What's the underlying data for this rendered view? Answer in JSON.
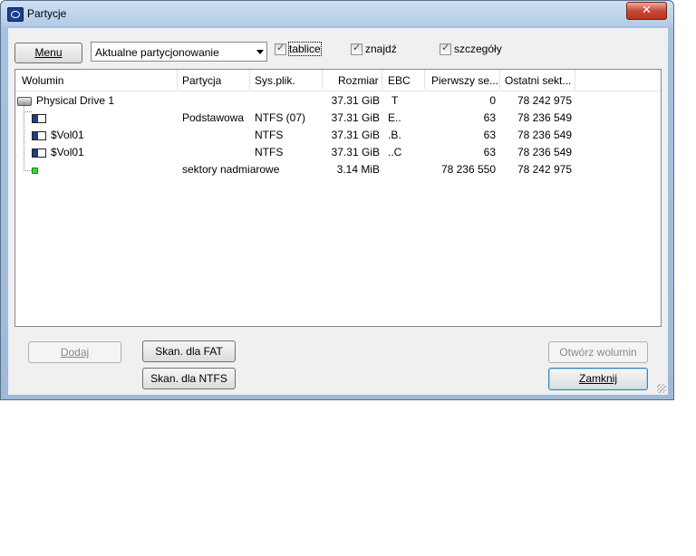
{
  "window": {
    "title": "Partycje",
    "close_symbol": "✕"
  },
  "toolbar": {
    "menu_label": "Menu",
    "combo_value": "Aktualne partycjonowanie",
    "checkboxes": [
      {
        "label": "tablice",
        "checked": true
      },
      {
        "label": "znajdź",
        "checked": true
      },
      {
        "label": "szczegóły",
        "checked": true
      }
    ]
  },
  "table": {
    "columns": [
      "Wolumin",
      "Partycja",
      "Sys.plik.",
      "Rozmiar",
      "EBC",
      "Pierwszy se...",
      "Ostatni sekt..."
    ],
    "rows": [
      {
        "icon": "drive-icon",
        "wolumin": "Physical Drive 1",
        "partycja": "",
        "sys": "",
        "rozmiar": "37.31 GiB",
        "ebc": "T",
        "first": "0",
        "last": "78 242 975"
      },
      {
        "icon": "volume-icon",
        "wolumin": "",
        "partycja": "Podstawowa",
        "sys": "NTFS (07)",
        "rozmiar": "37.31 GiB",
        "ebc": "E..",
        "first": "63",
        "last": "78 236 549"
      },
      {
        "icon": "volume-icon",
        "wolumin": "$Vol01",
        "partycja": "",
        "sys": "NTFS",
        "rozmiar": "37.31 GiB",
        "ebc": ".B.",
        "first": "63",
        "last": "78 236 549"
      },
      {
        "icon": "volume-icon",
        "wolumin": "$Vol01",
        "partycja": "",
        "sys": "NTFS",
        "rozmiar": "37.31 GiB",
        "ebc": "..C",
        "first": "63",
        "last": "78 236 549"
      },
      {
        "icon": "free-space-icon",
        "wolumin": "",
        "partycja": "sektory nadmiarowe",
        "sys": "",
        "rozmiar": "3.14 MiB",
        "ebc": "",
        "first": "78 236 550",
        "last": "78 242 975"
      }
    ]
  },
  "buttons": {
    "add": "Dodaj",
    "scan_fat": "Skan. dla FAT",
    "scan_ntfs": "Skan. dla NTFS",
    "open_volume": "Otwórz wolumin",
    "close": "Zamknij"
  }
}
